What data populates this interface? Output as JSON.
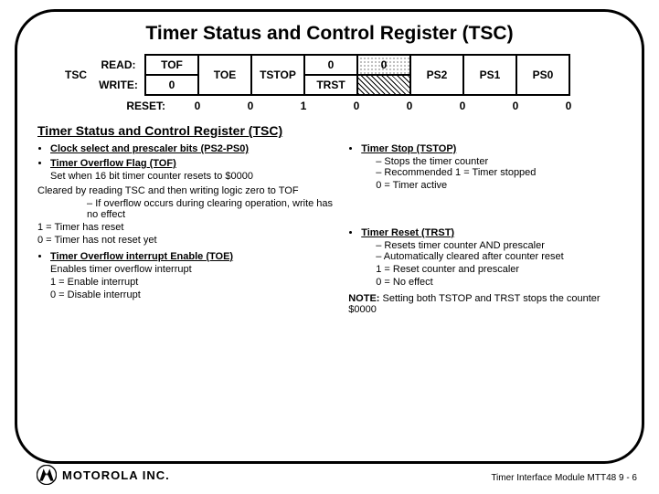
{
  "title": "Timer Status and Control Register (TSC)",
  "register": {
    "name": "TSC",
    "rows": {
      "read_label": "READ:",
      "write_label": "WRITE:",
      "reset_label": "RESET:"
    },
    "read": [
      "TOF",
      "TOE",
      "TSTOP",
      "0",
      "0",
      "PS2",
      "PS1",
      "PS0"
    ],
    "write": [
      "0",
      "TOE",
      "TSTOP",
      "TRST",
      "",
      "PS2",
      "PS1",
      "PS0"
    ],
    "reset": [
      "0",
      "0",
      "1",
      "0",
      "0",
      "0",
      "0",
      "0"
    ]
  },
  "section_title": "Timer Status and Control Register (TSC)",
  "left": {
    "b1": "Clock select and prescaler bits (PS2-PS0)",
    "b2": "Timer Overflow Flag (TOF)",
    "b2_l1": "Set when 16 bit timer counter resets to $0000",
    "b2_l2": "Cleared by reading TSC and then writing logic zero to TOF",
    "b2_d1": "If overflow occurs during clearing operation, write has no effect",
    "b2_l3": "1 = Timer has reset",
    "b2_l4": "0 = Timer has not reset yet",
    "b3": "Timer Overflow interrupt Enable (TOE)",
    "b3_l1": "Enables timer overflow interrupt",
    "b3_l2": "1 = Enable interrupt",
    "b3_l3": "0 = Disable interrupt"
  },
  "right": {
    "b1": "Timer Stop (TSTOP)",
    "b1_d1": "Stops the timer counter",
    "b1_d2": "Recommended 1 = Timer stopped",
    "b1_l1": "0 = Timer active",
    "b2": "Timer Reset (TRST)",
    "b2_d1": "Resets timer counter AND prescaler",
    "b2_d2": "Automatically cleared after counter reset",
    "b2_l1": "1 = Reset counter and prescaler",
    "b2_l2": "0 = No effect",
    "note_label": "NOTE:",
    "note_text": " Setting both TSTOP and TRST stops the counter $0000"
  },
  "logo_text": "MOTOROLA INC.",
  "footer": "Timer Interface Module MTT48  9 - 6"
}
